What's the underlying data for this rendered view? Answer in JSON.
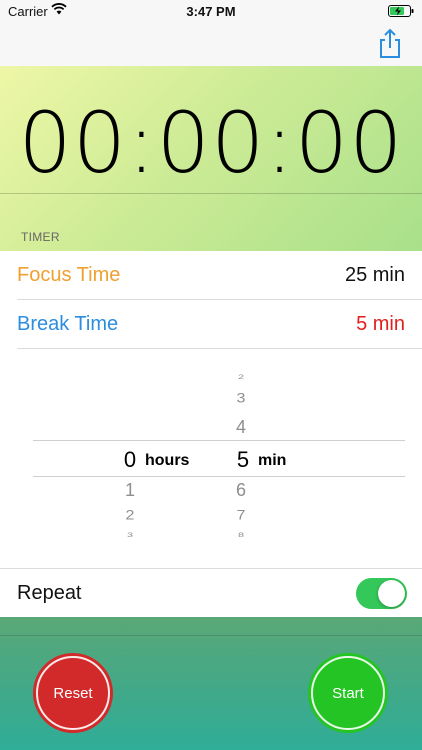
{
  "status_bar": {
    "carrier": "Carrier",
    "time": "3:47 PM"
  },
  "timer": {
    "display": "00:00:00",
    "section_header": "TIMER"
  },
  "settings": {
    "focus": {
      "label": "Focus Time",
      "value": "25 min",
      "label_color": "#f0a030",
      "value_color": "#111111"
    },
    "break": {
      "label": "Break Time",
      "value": "5 min",
      "label_color": "#2b8de0",
      "value_color": "#e0201e"
    }
  },
  "picker": {
    "hours_column": {
      "above": [],
      "selected": "0",
      "below": [
        "1",
        "2",
        "3"
      ],
      "unit": "hours"
    },
    "minutes_column": {
      "above": [
        "2",
        "3",
        "4"
      ],
      "selected": "5",
      "below": [
        "6",
        "7",
        "8"
      ],
      "unit": "min"
    }
  },
  "repeat": {
    "label": "Repeat",
    "enabled": true
  },
  "actions": {
    "reset_label": "Reset",
    "start_label": "Start"
  },
  "icons": {
    "wifi": "wifi-icon",
    "battery": "battery-charging-icon",
    "share": "share-icon"
  },
  "colors": {
    "toggle_on": "#34c759",
    "reset": "#d22a2a",
    "start": "#23c423",
    "ios_blue": "#2b8de0"
  }
}
